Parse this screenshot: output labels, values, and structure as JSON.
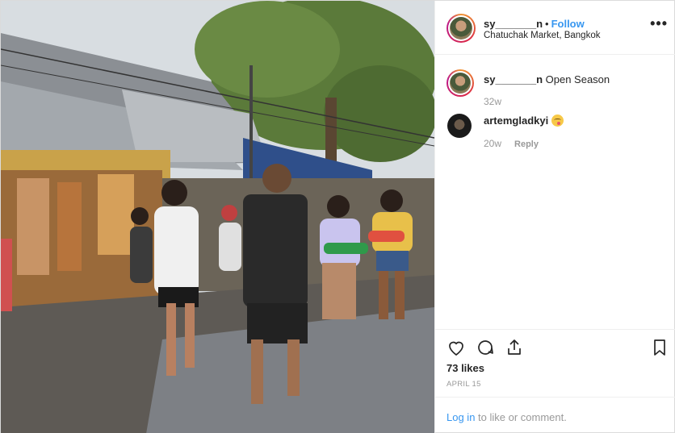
{
  "post": {
    "username": "sy_______n",
    "dot": "•",
    "follow_label": "Follow",
    "location": "Chatuchak Market, Bangkok",
    "more_label": "•••"
  },
  "comments": [
    {
      "username": "sy_______n",
      "text": "Open Season",
      "time": "32w"
    },
    {
      "username": "artemgladkyi",
      "text": "",
      "time": "20w",
      "reply_label": "Reply"
    }
  ],
  "actions": {
    "likes": "73 likes",
    "date": "APRIL 15"
  },
  "add_comment": {
    "login_label": "Log in",
    "suffix": " to like or comment."
  },
  "icons": [
    "heart-icon",
    "comment-icon",
    "share-icon",
    "bookmark-icon",
    "more-icon"
  ],
  "colors": {
    "link": "#3897f0",
    "muted": "#999999",
    "border": "#efefef"
  }
}
